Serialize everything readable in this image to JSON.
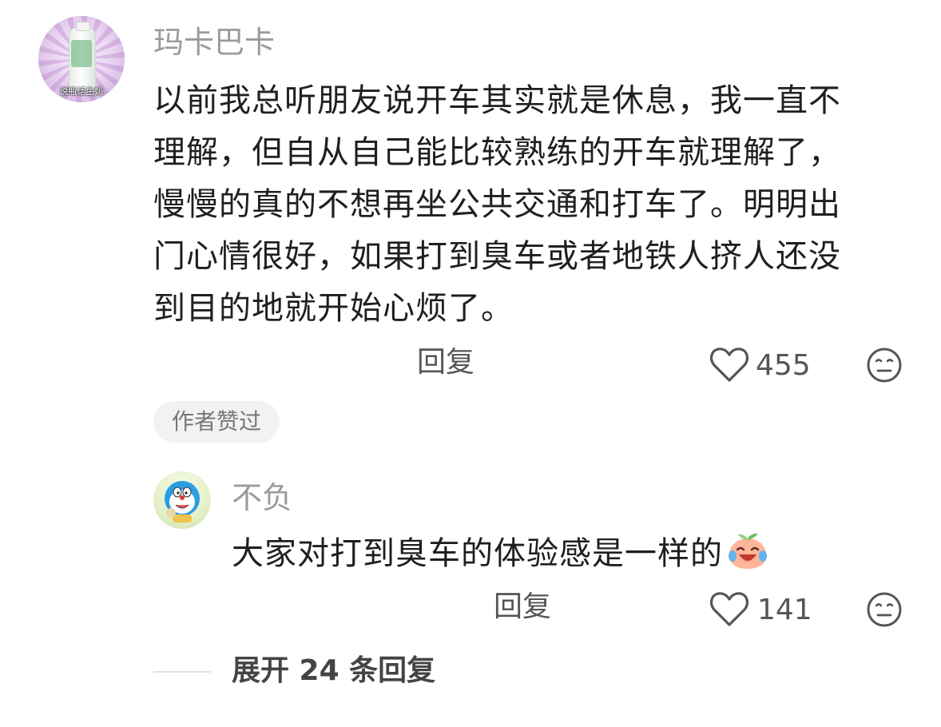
{
  "main_comment": {
    "username": "玛卡巴卡",
    "avatar_caption": "说瓶话生奶",
    "text_lines": [
      "以前我总听朋友说开车其实就是休息，我一直不",
      "理解，但自从自己能比较熟练的开车就理解了，",
      "慢慢的真的不想再坐公共交通和打车了。明明出",
      "门心情很好，如果打到臭车或者地铁人挤人还没",
      "到目的地就开始心烦了。"
    ],
    "reply_label": "回复",
    "like_icon": "heart-outline-icon",
    "like_count": "455",
    "dislike_icon": "meh-face-icon",
    "author_badge": "作者赞过"
  },
  "sub_reply": {
    "username": "不负",
    "text": "大家对打到臭车的体验感是一样的",
    "emoji": "crying-laughing-peach-emoji",
    "reply_label": "回复",
    "like_icon": "heart-outline-icon",
    "like_count": "141",
    "dislike_icon": "meh-face-icon"
  },
  "expand": {
    "label": "展开 24 条回复"
  }
}
